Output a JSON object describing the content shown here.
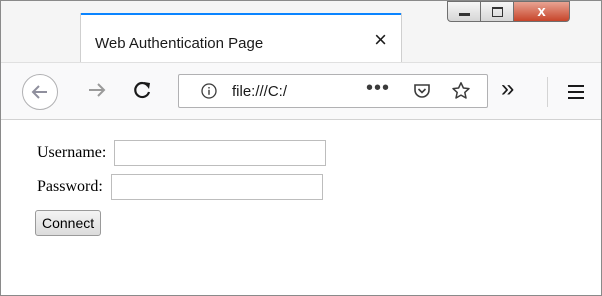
{
  "tab": {
    "title": "Web Authentication Page",
    "close_glyph": "×"
  },
  "window_controls": {
    "close_glyph": "x"
  },
  "toolbar": {
    "url": "file:///C:/",
    "page_actions_glyph": "•••",
    "overflow_glyph": "»",
    "icons": [
      "back-arrow-icon",
      "forward-arrow-icon",
      "reload-icon",
      "info-icon",
      "pocket-icon",
      "bookmark-star-icon",
      "overflow-chevron-icon",
      "hamburger-menu-icon"
    ]
  },
  "form": {
    "username_label": "Username:",
    "username_value": "",
    "password_label": "Password:",
    "password_value": "",
    "connect_label": "Connect"
  },
  "colors": {
    "tab_accent": "#0a84ff",
    "close_button": "#c7452a"
  }
}
